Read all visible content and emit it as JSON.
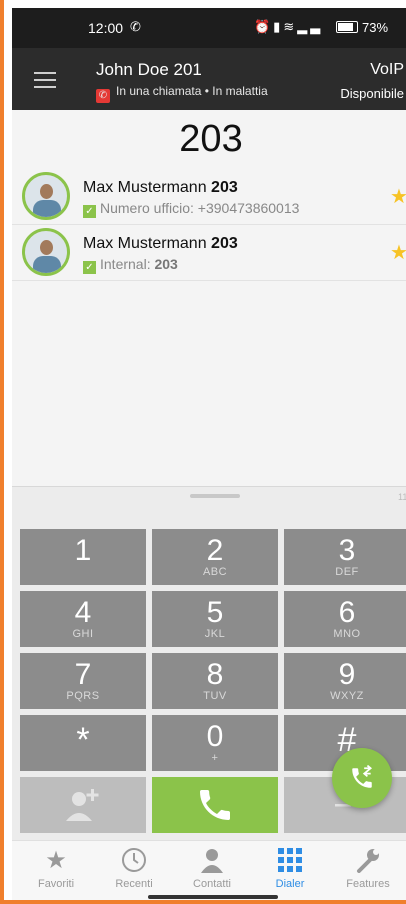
{
  "status_bar": {
    "time": "12:00",
    "battery": "73%"
  },
  "header": {
    "user_name": "John Doe 201",
    "status_text": "In una chiamata • In malattia",
    "service": "VoIP",
    "availability": "Disponibile"
  },
  "dial_number": "203",
  "contacts": [
    {
      "name": "Max Mustermann",
      "ext": "203",
      "detail_label": "Numero ufficio:",
      "detail_value": "+390473860013"
    },
    {
      "name": "Max Mustermann",
      "ext": "203",
      "detail_label": "Internal:",
      "detail_value": "203"
    }
  ],
  "input_length": "11",
  "keypad": [
    {
      "digit": "1",
      "letters": ""
    },
    {
      "digit": "2",
      "letters": "ABC"
    },
    {
      "digit": "3",
      "letters": "DEF"
    },
    {
      "digit": "4",
      "letters": "GHI"
    },
    {
      "digit": "5",
      "letters": "JKL"
    },
    {
      "digit": "6",
      "letters": "MNO"
    },
    {
      "digit": "7",
      "letters": "PQRS"
    },
    {
      "digit": "8",
      "letters": "TUV"
    },
    {
      "digit": "9",
      "letters": "WXYZ"
    },
    {
      "digit": "*",
      "letters": ""
    },
    {
      "digit": "0",
      "letters": "+"
    },
    {
      "digit": "#",
      "letters": ""
    }
  ],
  "nav": [
    {
      "label": "Favoriti",
      "icon": "star-icon"
    },
    {
      "label": "Recenti",
      "icon": "clock-icon"
    },
    {
      "label": "Contatti",
      "icon": "person-icon"
    },
    {
      "label": "Dialer",
      "icon": "keypad-icon"
    },
    {
      "label": "Features",
      "icon": "wrench-icon"
    }
  ],
  "colors": {
    "accent_green": "#8bc34a",
    "active_blue": "#2f8de4",
    "frame_orange": "#f07f2d",
    "call_red": "#e53935"
  }
}
